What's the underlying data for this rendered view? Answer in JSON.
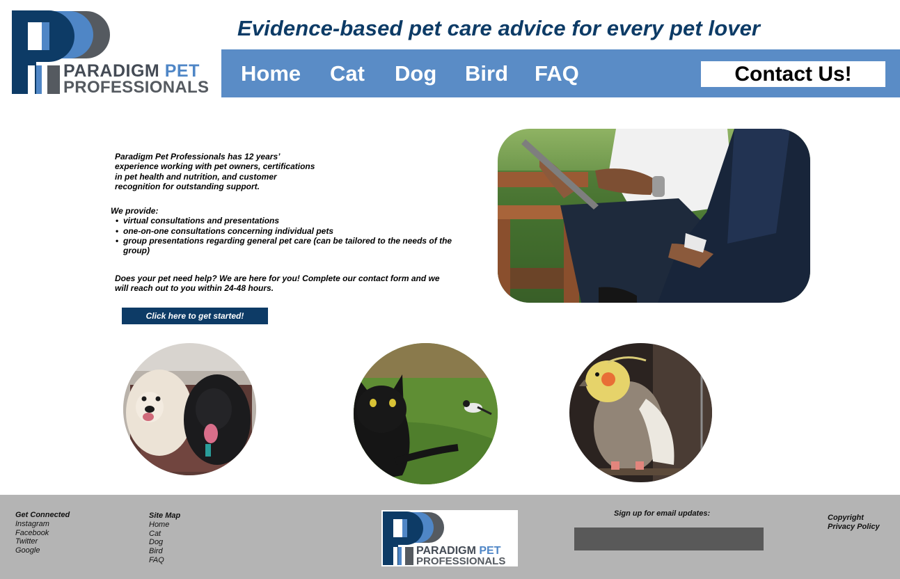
{
  "brand": {
    "name_part1": "PARADIGM",
    "name_part2": "PET",
    "name_line2": "PROFESSIONALS",
    "colors": {
      "navy": "#0d3b66",
      "blue": "#5a8cc6",
      "accent": "#4f86c6",
      "gray": "#555a60"
    }
  },
  "header": {
    "tagline": "Evidence-based pet care advice for every pet lover"
  },
  "nav": {
    "items": [
      {
        "label": "Home"
      },
      {
        "label": "Cat"
      },
      {
        "label": "Dog"
      },
      {
        "label": "Bird"
      },
      {
        "label": "FAQ"
      }
    ],
    "contact_label": "Contact Us!"
  },
  "main": {
    "intro": "Paradigm Pet Professionals has 12 years’ experience working with pet owners, certifications in pet health and nutrition, and customer recognition for outstanding support.",
    "provide_heading": "We provide:",
    "provide_items": [
      "virtual consultations and presentations",
      "one-on-one consultations concerning individual pets",
      "group presentations regarding general pet care (can be tailored to the needs of the group)"
    ],
    "cta_text": "Does your pet need help? We are here for you! Complete our contact form and we will reach out to you within 24-48 hours.",
    "cta_button": "Click here to get started!"
  },
  "footer": {
    "connect": {
      "heading": "Get Connected",
      "links": [
        "Instagram",
        "Facebook",
        "Twitter",
        "Google"
      ]
    },
    "sitemap": {
      "heading": "Site Map",
      "links": [
        "Home",
        "Cat",
        "Dog",
        "Bird",
        "FAQ"
      ]
    },
    "signup_label": "Sign up for email updates:",
    "email_value": "",
    "legal": [
      "Copyright",
      "Privacy Policy"
    ]
  }
}
